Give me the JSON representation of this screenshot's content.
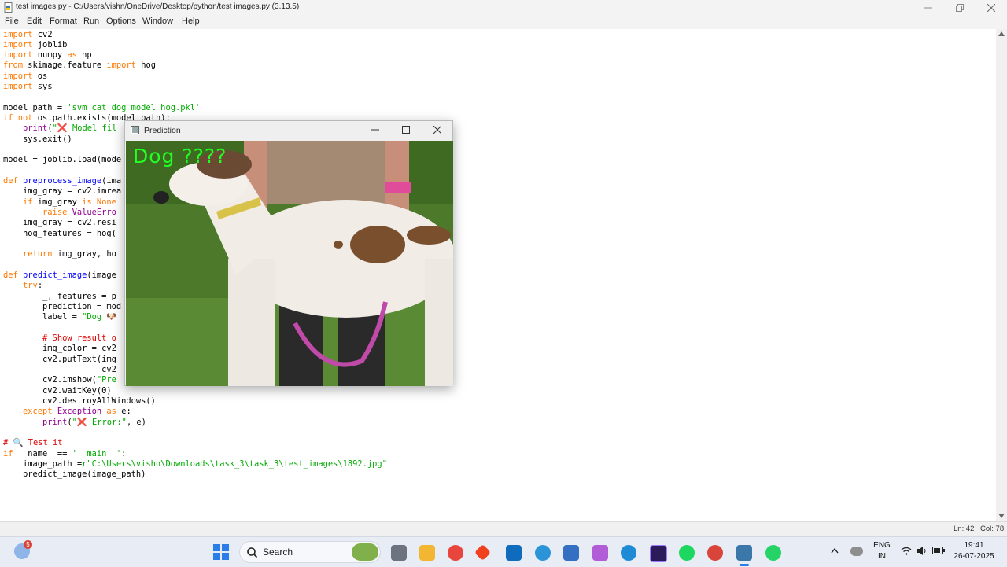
{
  "window": {
    "title": "test images.py - C:/Users/vishn/OneDrive/Desktop/python/test images.py (3.13.5)"
  },
  "menu": [
    "File",
    "Edit",
    "Format",
    "Run",
    "Options",
    "Window",
    "Help"
  ],
  "code": {
    "line1": [
      "import",
      " cv2"
    ],
    "line2": [
      "import",
      " joblib"
    ],
    "line3": [
      "import",
      " numpy ",
      "as",
      " np"
    ],
    "line4": [
      "from",
      " skimage.feature ",
      "import",
      " hog"
    ],
    "line5": [
      "import",
      " os"
    ],
    "line6": [
      "import",
      " sys"
    ],
    "line8": [
      "model_path = ",
      "'svm_cat_dog_model_hog.pkl'"
    ],
    "line9": [
      "if not",
      " os.path.exists(model_path):"
    ],
    "line10": [
      "    ",
      "print",
      "(",
      "\"❌ Model fil"
    ],
    "line11": [
      "    sys.exit()"
    ],
    "line13": [
      "model = joblib.load(mode"
    ],
    "line15": [
      "def",
      " ",
      "preprocess_image",
      "(ima"
    ],
    "line16": [
      "    img_gray = cv2.imrea"
    ],
    "line17": [
      "    ",
      "if",
      " img_gray ",
      "is",
      " ",
      "None"
    ],
    "line18": [
      "        ",
      "raise",
      " ",
      "ValueErro"
    ],
    "line19": [
      "    img_gray = cv2.resi"
    ],
    "line20": [
      "    hog_features = hog("
    ],
    "line22": [
      "    ",
      "return",
      " img_gray, ho"
    ],
    "line24": [
      "def",
      " ",
      "predict_image",
      "(image"
    ],
    "line25": [
      "    ",
      "try",
      ":"
    ],
    "line26": [
      "        _, features = p"
    ],
    "line27": [
      "        prediction = mod"
    ],
    "line28": [
      "        label = ",
      "\"Dog 🐶"
    ],
    "line30": [
      "        ",
      "# Show result o"
    ],
    "line31": [
      "        img_color = cv2"
    ],
    "line32": [
      "        cv2.putText(img"
    ],
    "line33": [
      "                    cv2"
    ],
    "line34": [
      "        cv2.imshow(",
      "\"Pre"
    ],
    "line35": [
      "        cv2.waitKey(0)"
    ],
    "line36": [
      "        cv2.destroyAllWindows()"
    ],
    "line37": [
      "    ",
      "except",
      " ",
      "Exception",
      " ",
      "as",
      " e:"
    ],
    "line38": [
      "        ",
      "print",
      "(",
      "\"❌ Error:\"",
      ", e)"
    ],
    "line40": [
      "# 🔍 Test it"
    ],
    "line41": [
      "if",
      " __name__== ",
      "'__main__'",
      ":"
    ],
    "line42": [
      "    image_path =",
      "r\"C:\\Users\\vishn\\Downloads\\task_3\\task_3\\test_images\\1892.jpg\""
    ],
    "line43": [
      "    predict_image(image_path)"
    ]
  },
  "status": {
    "line": "Ln: 42",
    "col": "Col: 78"
  },
  "prediction_window": {
    "title": "Prediction",
    "label": "Dog ????"
  },
  "taskbar": {
    "search_placeholder": "Search",
    "notification_count": "5",
    "language": "ENG",
    "region": "IN",
    "time": "19:41",
    "date": "26-07-2025"
  }
}
